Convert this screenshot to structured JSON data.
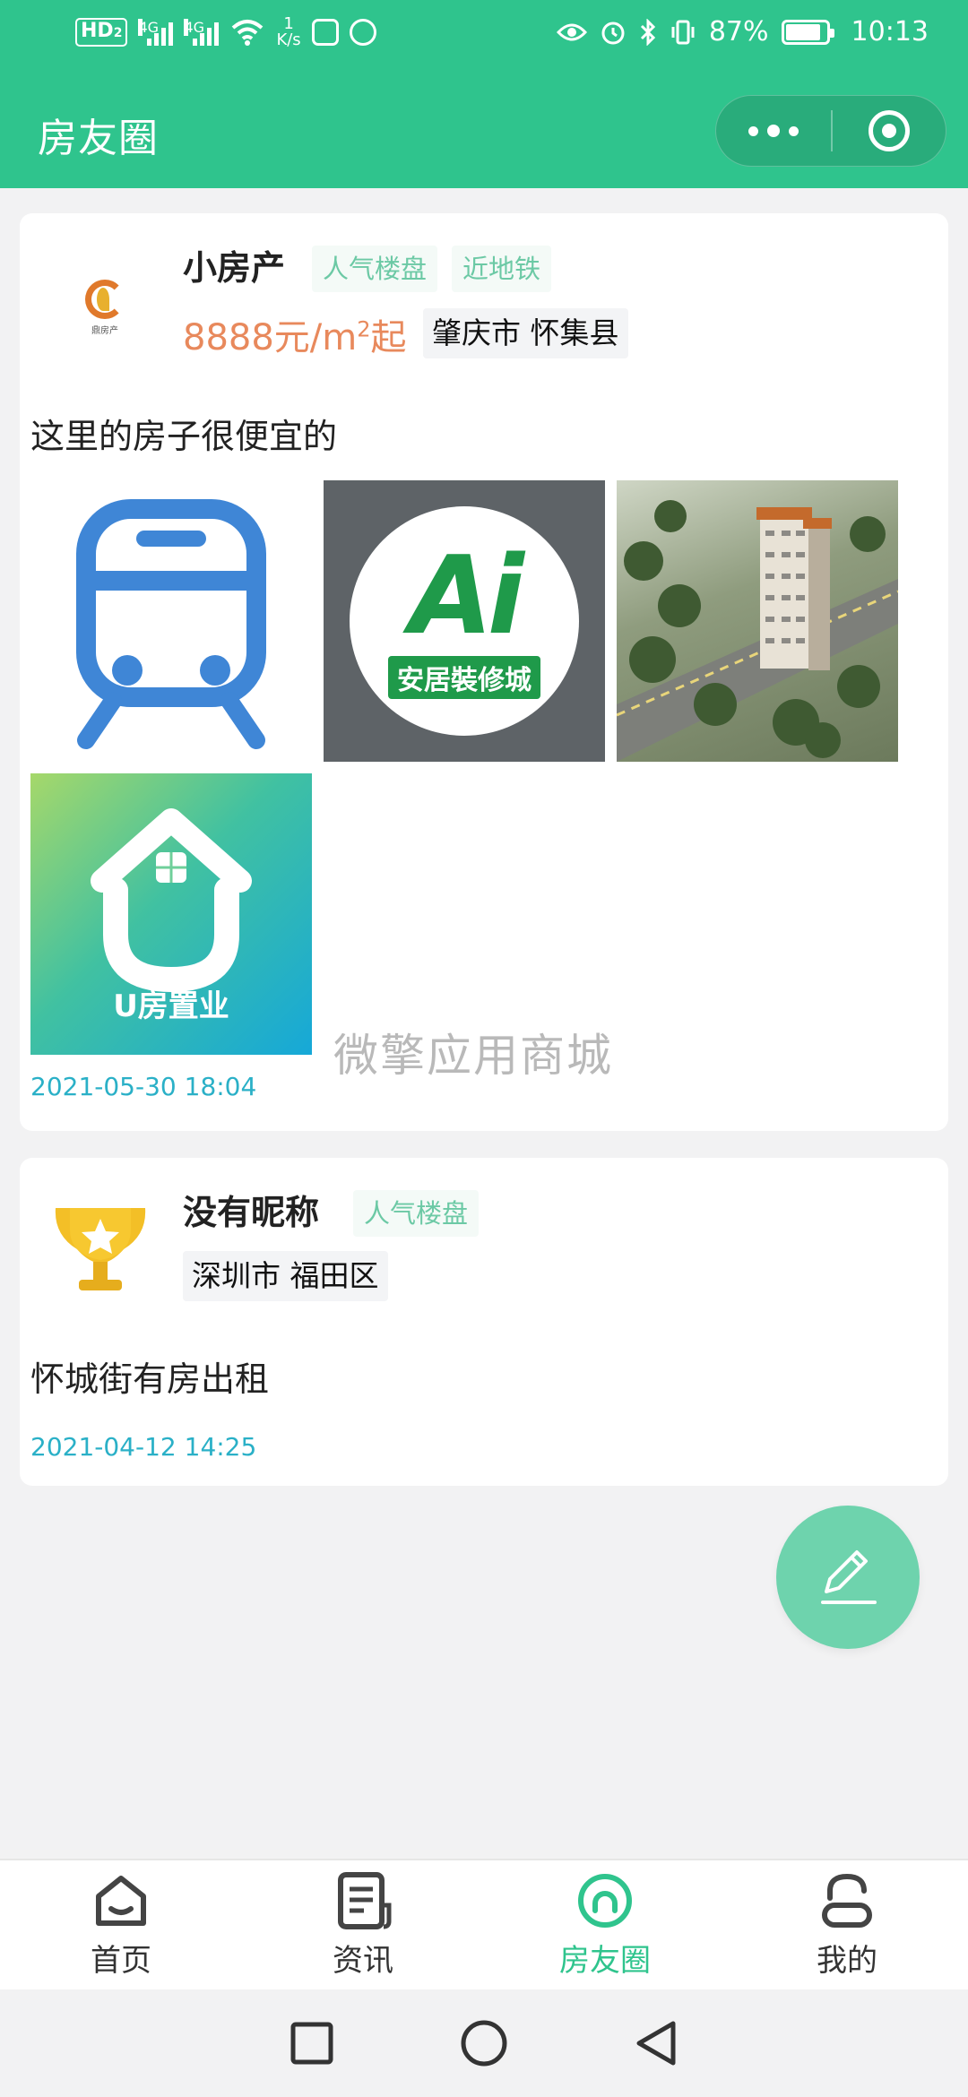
{
  "status_bar": {
    "hd": "HD",
    "hd_sub": "2",
    "net1": "4G",
    "net2": "4G",
    "speed_value": "1",
    "speed_unit": "K/s",
    "battery": "87%",
    "time": "10:13"
  },
  "header": {
    "title": "房友圈"
  },
  "posts": [
    {
      "user_name": "小房产",
      "avatar_logo_text": "鼎房产",
      "tags": [
        "人气楼盘",
        "近地铁"
      ],
      "price_prefix": "8888元/m",
      "price_sup": "2",
      "price_suffix": "起",
      "location": "肇庆市 怀集县",
      "text": "这里的房子很便宜的",
      "images": [
        {
          "icon": "metro-icon"
        },
        {
          "icon": "anju-logo",
          "logo_text": "Ai",
          "logo_name": "安居裝修城"
        },
        {
          "icon": "building-photo"
        },
        {
          "icon": "ufang-logo",
          "logo_name": "U房置业"
        }
      ],
      "time": "2021-05-30 18:04"
    },
    {
      "user_name": "没有昵称",
      "tags": [
        "人气楼盘"
      ],
      "location": "深圳市 福田区",
      "text": "怀城街有房出租",
      "time": "2021-04-12 14:25"
    }
  ],
  "watermark": "微擎应用商城",
  "tabbar": {
    "items": [
      {
        "label": "首页",
        "icon": "home-icon",
        "active": false
      },
      {
        "label": "资讯",
        "icon": "news-icon",
        "active": false
      },
      {
        "label": "房友圈",
        "icon": "circle-icon",
        "active": true
      },
      {
        "label": "我的",
        "icon": "profile-icon",
        "active": false
      }
    ]
  },
  "colors": {
    "brand": "#2fc48d",
    "price": "#e8895c",
    "tag": "#6cc9a5",
    "timestamp": "#2ab0c7",
    "fab": "#6ed3ad"
  }
}
